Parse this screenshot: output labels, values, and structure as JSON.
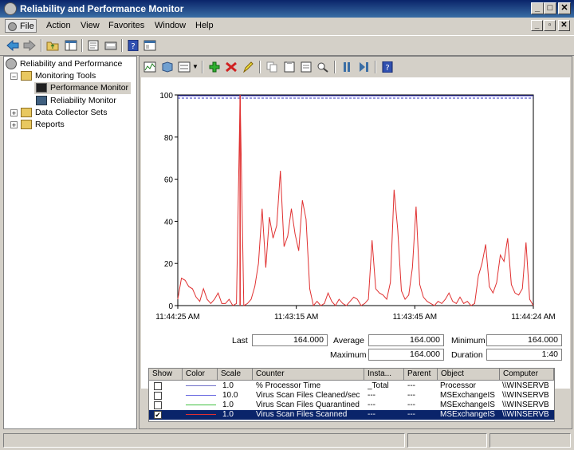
{
  "window": {
    "title": "Reliability and Performance Monitor"
  },
  "titlebar_buttons": {
    "minimize": "_",
    "maximize": "□",
    "close": "✕"
  },
  "menu": {
    "items": [
      "File",
      "Action",
      "View",
      "Favorites",
      "Window",
      "Help"
    ]
  },
  "mdi_buttons": {
    "minimize": "_",
    "restore": "▫",
    "close": "✕"
  },
  "tree": {
    "root": "Reliability and Performance",
    "monitoring_tools": "Monitoring Tools",
    "performance_monitor": "Performance Monitor",
    "reliability_monitor": "Reliability Monitor",
    "data_collector_sets": "Data Collector Sets",
    "reports": "Reports"
  },
  "stats": {
    "last_label": "Last",
    "last_value": "164.000",
    "average_label": "Average",
    "average_value": "164.000",
    "minimum_label": "Minimum",
    "minimum_value": "164.000",
    "maximum_label": "Maximum",
    "maximum_value": "164.000",
    "duration_label": "Duration",
    "duration_value": "1:40"
  },
  "legend": {
    "headers": [
      "Show",
      "Color",
      "Scale",
      "Counter",
      "Insta...",
      "Parent",
      "Object",
      "Computer"
    ],
    "rows": [
      {
        "checked": false,
        "color": "#7070c8",
        "scale": "1.0",
        "counter": "% Processor Time",
        "instance": "_Total",
        "parent": "---",
        "object": "Processor",
        "computer": "\\\\WINSERVB",
        "selected": false
      },
      {
        "checked": false,
        "color": "#6a6ae0",
        "scale": "10.0",
        "counter": "Virus Scan Files Cleaned/sec",
        "instance": "---",
        "parent": "---",
        "object": "MSExchangeIS",
        "computer": "\\\\WINSERVB",
        "selected": false
      },
      {
        "checked": false,
        "color": "#40c040",
        "scale": "1.0",
        "counter": "Virus Scan Files Quarantined",
        "instance": "---",
        "parent": "---",
        "object": "MSExchangeIS",
        "computer": "\\\\WINSERVB",
        "selected": false
      },
      {
        "checked": true,
        "color": "#e03030",
        "scale": "1.0",
        "counter": "Virus Scan Files Scanned",
        "instance": "---",
        "parent": "---",
        "object": "MSExchangeIS",
        "computer": "\\\\WINSERVB",
        "selected": true
      }
    ]
  },
  "chart_data": {
    "type": "line",
    "ylim": [
      0,
      100
    ],
    "yticks": [
      "100",
      "80",
      "60",
      "40",
      "20",
      "0"
    ],
    "xticks": [
      "11:44:25 AM",
      "11:43:15 AM",
      "11:43:45 AM",
      "11:44:24 AM"
    ],
    "series": [
      {
        "color": "#e03030",
        "values": [
          3,
          13,
          12,
          9,
          8,
          4,
          2,
          8,
          3,
          1,
          3,
          6,
          1,
          1,
          3,
          0,
          1,
          100,
          0,
          1,
          3,
          9,
          20,
          46,
          18,
          42,
          32,
          38,
          64,
          28,
          33,
          46,
          34,
          26,
          50,
          41,
          8,
          0,
          2,
          0,
          1,
          6,
          2,
          0,
          3,
          1,
          0,
          2,
          4,
          3,
          0,
          1,
          3,
          31,
          8,
          6,
          5,
          3,
          11,
          55,
          36,
          7,
          3,
          5,
          18,
          47,
          10,
          4,
          2,
          1,
          0,
          2,
          1,
          3,
          6,
          2,
          1,
          4,
          1,
          2,
          0,
          1,
          14,
          20,
          29,
          9,
          6,
          11,
          24,
          21,
          32,
          10,
          6,
          5,
          8,
          30,
          3,
          0
        ],
        "gap_at": 17
      }
    ],
    "markers": {
      "cursor_index": 17
    }
  },
  "status": {
    "panels": [
      "",
      "",
      ""
    ]
  }
}
